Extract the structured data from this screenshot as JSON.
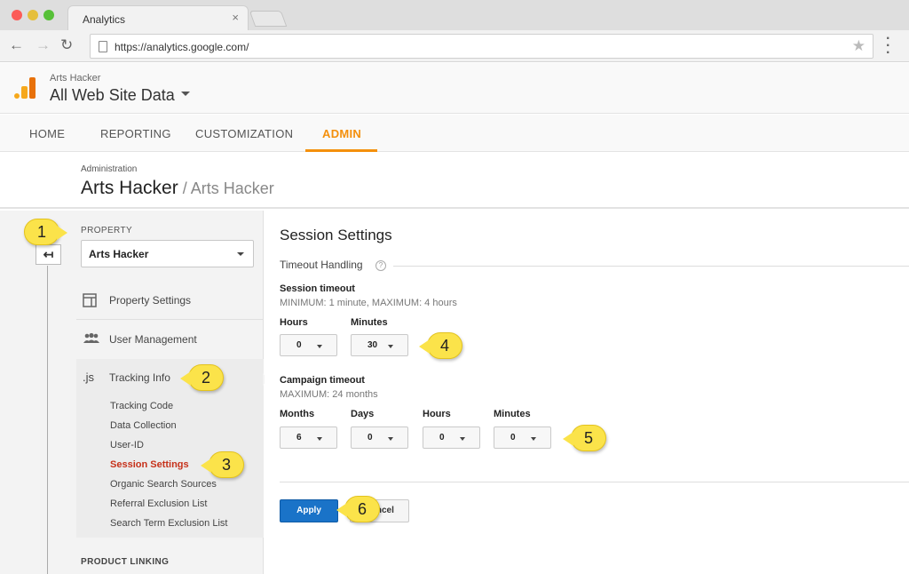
{
  "browser": {
    "tab_title": "Analytics",
    "tab_close": "×",
    "url": "https://analytics.google.com/",
    "back_icon": "←",
    "forward_icon": "→",
    "reload_icon": "↻",
    "star_icon": "★",
    "menu_icon": "⋮"
  },
  "header": {
    "account": "Arts Hacker",
    "view": "All Web Site Data"
  },
  "main_nav": [
    "HOME",
    "REPORTING",
    "CUSTOMIZATION",
    "ADMIN"
  ],
  "breadcrumb": {
    "small": "Administration",
    "title": "Arts Hacker",
    "subtitle": " / Arts Hacker"
  },
  "left": {
    "back_icon": "↤",
    "property_label": "PROPERTY",
    "property_value": "Arts Hacker",
    "menu": {
      "property_settings": "Property Settings",
      "user_management": "User Management",
      "tracking_info": "Tracking Info",
      "tracking_icon": ".js"
    },
    "tracking_items": [
      "Tracking Code",
      "Data Collection",
      "User-ID",
      "Session Settings",
      "Organic Search Sources",
      "Referral Exclusion List",
      "Search Term Exclusion List"
    ],
    "product_linking": "PRODUCT LINKING"
  },
  "session": {
    "title": "Session Settings",
    "timeout_heading": "Timeout Handling",
    "help": "?",
    "session_timeout": {
      "label": "Session timeout",
      "hint": "MINIMUM: 1 minute, MAXIMUM: 4 hours",
      "hours_label": "Hours",
      "hours_value": "0",
      "minutes_label": "Minutes",
      "minutes_value": "30"
    },
    "campaign_timeout": {
      "label": "Campaign timeout",
      "hint": "MAXIMUM: 24 months",
      "months_label": "Months",
      "months_value": "6",
      "days_label": "Days",
      "days_value": "0",
      "hours_label": "Hours",
      "hours_value": "0",
      "minutes_label": "Minutes",
      "minutes_value": "0"
    },
    "apply": "Apply",
    "cancel": "Cancel"
  },
  "callouts": [
    "1",
    "2",
    "3",
    "4",
    "5",
    "6"
  ],
  "colors": {
    "accent": "#f4900c",
    "apply_blue": "#1a73c8",
    "callout_yellow": "#fbe34a",
    "active_link": "#c6311a"
  }
}
